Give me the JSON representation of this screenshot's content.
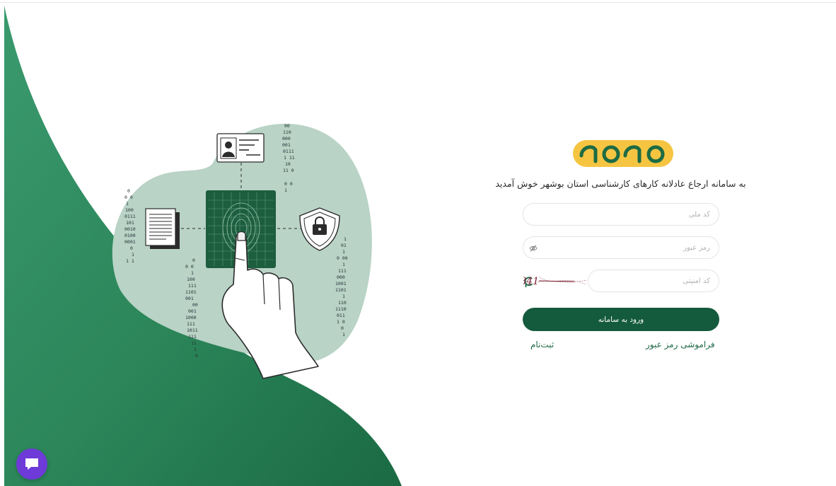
{
  "login": {
    "welcome_text": "به سامانه ارجاع عادلانه کارهای کارشناسی استان بوشهر خوش آمدید",
    "national_code_placeholder": "کد ملی",
    "password_placeholder": "رمز عبور",
    "captcha_placeholder": "کد امنیتی",
    "captcha_code": "935841",
    "submit_label": "ورود به سامانه",
    "forgot_password_label": "فراموشی رمز عبور",
    "register_label": "ثبت‌نام"
  },
  "icons": {
    "password_toggle": "eye-off-icon",
    "captcha_refresh": "refresh-icon",
    "chat": "chat-icon"
  },
  "colors": {
    "brand_green": "#145a3c",
    "hero_green": "#2e8a5c",
    "logo_yellow": "#f5c542",
    "chat_purple": "#6e3ad8"
  }
}
